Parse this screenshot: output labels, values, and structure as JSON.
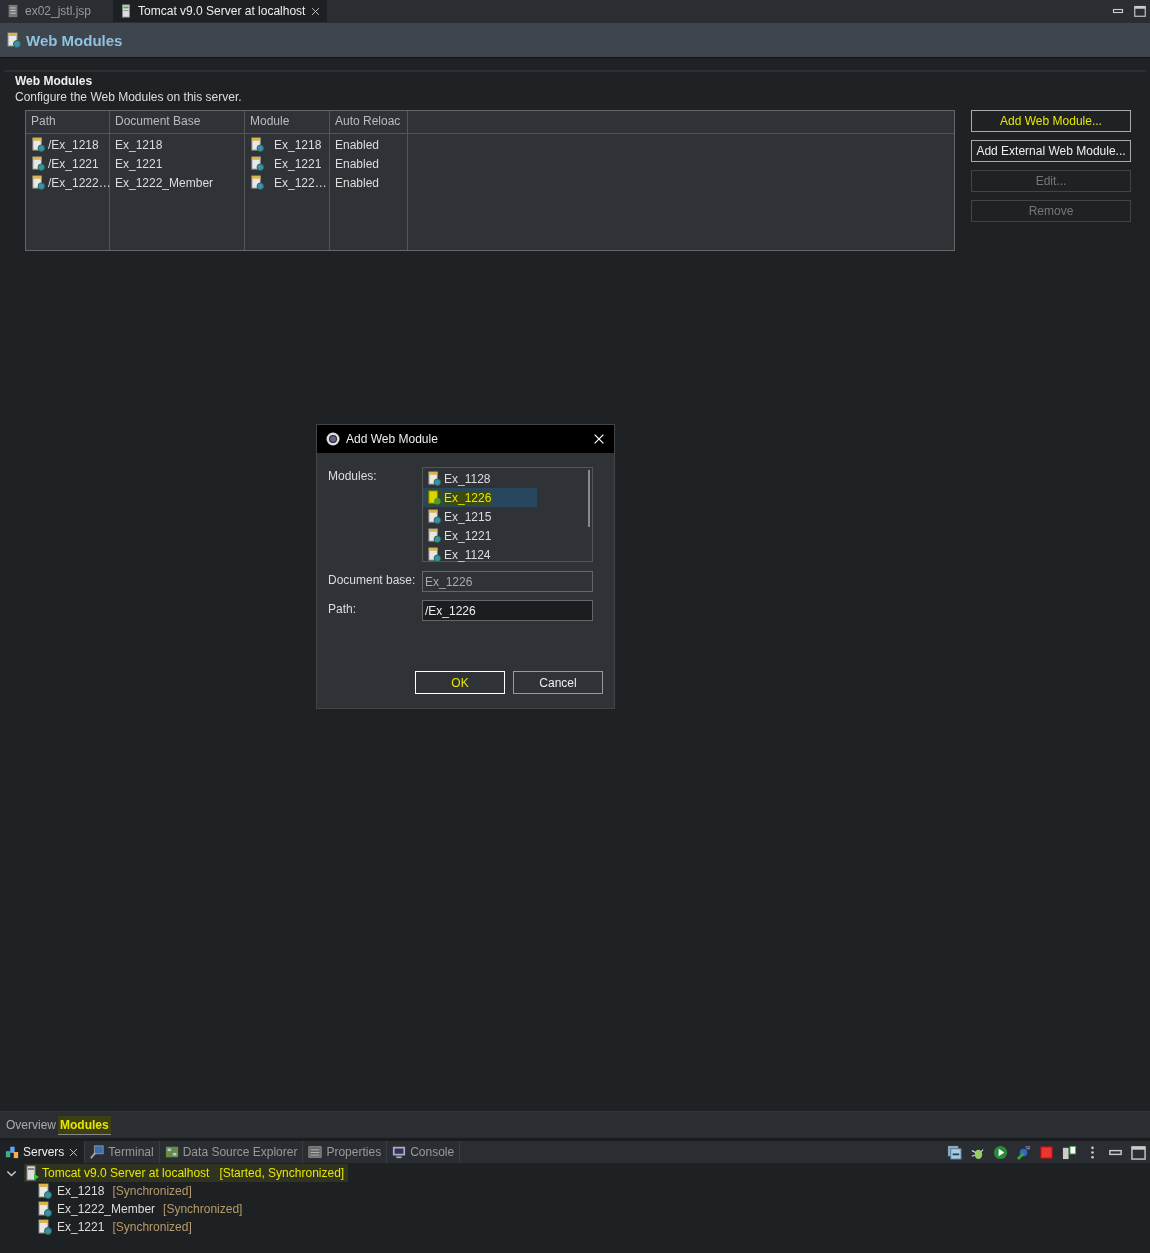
{
  "editor_tabs": [
    {
      "label": "ex02_jstl.jsp",
      "kind": "file",
      "selected": false,
      "closable": false
    },
    {
      "label": "Tomcat v9.0 Server at localhost",
      "kind": "server",
      "selected": true,
      "closable": true
    }
  ],
  "header": {
    "title": "Web Modules"
  },
  "section": {
    "title": "Web Modules",
    "description": "Configure the Web Modules on this server."
  },
  "table": {
    "columns": [
      "Path",
      "Document Base",
      "Module",
      "Auto Reloac"
    ],
    "rows": [
      {
        "path": "/Ex_1218",
        "document_base": "Ex_1218",
        "module": "Ex_1218",
        "auto_reload": "Enabled"
      },
      {
        "path": "/Ex_1221",
        "document_base": "Ex_1221",
        "module": "Ex_1221",
        "auto_reload": "Enabled"
      },
      {
        "path": "/Ex_1222…",
        "document_base": "Ex_1222_Member",
        "module": "Ex_122…",
        "auto_reload": "Enabled"
      }
    ]
  },
  "buttons": [
    {
      "label": "Add Web Module...",
      "disabled": false,
      "highlighted": true
    },
    {
      "label": "Add External Web Module...",
      "disabled": false,
      "highlighted": false
    },
    {
      "label": "Edit...",
      "disabled": true,
      "highlighted": false
    },
    {
      "label": "Remove",
      "disabled": true,
      "highlighted": false
    }
  ],
  "dialog": {
    "title": "Add Web Module",
    "modules_label": "Modules:",
    "modules": [
      {
        "label": "Ex_1128",
        "selected": false,
        "highlighted": false
      },
      {
        "label": "Ex_1226",
        "selected": true,
        "highlighted": true
      },
      {
        "label": "Ex_1215",
        "selected": false,
        "highlighted": false
      },
      {
        "label": "Ex_1221",
        "selected": false,
        "highlighted": false
      },
      {
        "label": "Ex_1124",
        "selected": false,
        "highlighted": false
      }
    ],
    "document_base_label": "Document base:",
    "document_base": {
      "value": "Ex_1226",
      "disabled": true
    },
    "path_label": "Path:",
    "path": {
      "value": "/Ex_1226",
      "disabled": false
    },
    "buttons": [
      {
        "label": "OK",
        "default": true,
        "highlighted": true
      },
      {
        "label": "Cancel",
        "default": false,
        "highlighted": false
      }
    ]
  },
  "page_tabs": [
    {
      "label": "Overview",
      "selected": false,
      "highlighted": false
    },
    {
      "label": "Modules",
      "selected": true,
      "highlighted": true
    }
  ],
  "view_tabs": [
    {
      "label": "Servers",
      "kind": "servers",
      "selected": true,
      "closable": true
    },
    {
      "label": "Terminal",
      "kind": "terminal",
      "selected": false,
      "closable": false
    },
    {
      "label": "Data Source Explorer",
      "kind": "datasource",
      "selected": false,
      "closable": false
    },
    {
      "label": "Properties",
      "kind": "properties",
      "selected": false,
      "closable": false
    },
    {
      "label": "Console",
      "kind": "console",
      "selected": false,
      "closable": false
    }
  ],
  "servers": [
    {
      "name": "Tomcat v9.0 Server at localhost",
      "status": "[Started, Synchronized]",
      "expanded": true,
      "highlighted": true,
      "children": [
        {
          "name": "Ex_1218",
          "status": "[Synchronized]"
        },
        {
          "name": "Ex_1222_Member",
          "status": "[Synchronized]"
        },
        {
          "name": "Ex_1221",
          "status": "[Synchronized]"
        }
      ]
    }
  ]
}
